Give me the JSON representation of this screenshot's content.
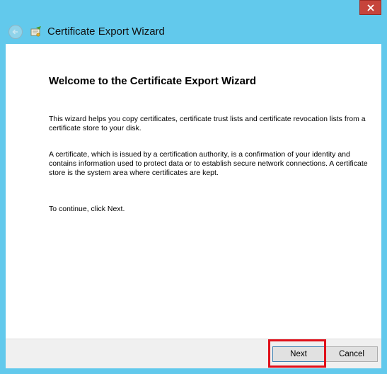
{
  "window": {
    "title": "Certificate Export Wizard",
    "close_symbol": "x",
    "frame_color": "#62c9ec",
    "close_color": "#c6443b"
  },
  "icons": {
    "close": "close-icon",
    "back": "back-arrow-icon",
    "wizard": "certificate-wizard-icon"
  },
  "content": {
    "heading": "Welcome to the Certificate Export Wizard",
    "paragraphs": [
      "This wizard helps you copy certificates, certificate trust lists and certificate revocation lists from a certificate store to your disk.",
      "A certificate, which is issued by a certification authority, is a confirmation of your identity and contains information used to protect data or to establish secure network connections. A certificate store is the system area where certificates are kept.",
      "To continue, click Next."
    ]
  },
  "buttons": {
    "next": "Next",
    "cancel": "Cancel"
  },
  "highlight": {
    "target": "next-button",
    "color": "#e0101a"
  }
}
